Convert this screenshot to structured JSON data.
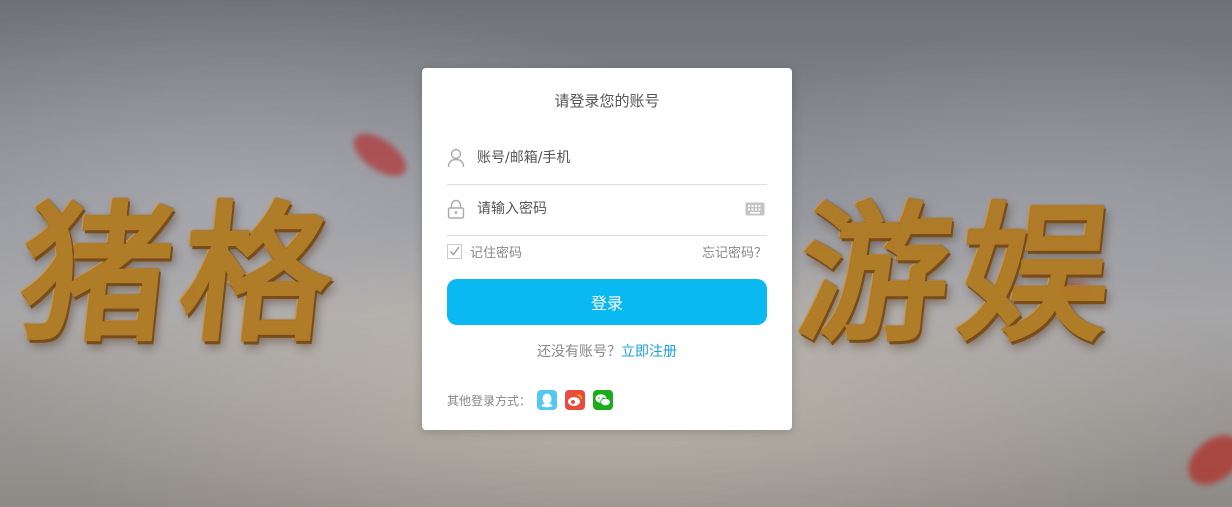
{
  "background": {
    "calligraphy_left": "猪格",
    "calligraphy_right": "游娱"
  },
  "login": {
    "title": "请登录您的账号",
    "username_placeholder": "账号/邮箱/手机",
    "password_placeholder": "请输入密码",
    "remember_label": "记住密码",
    "remember_checked": true,
    "forgot_label": "忘记密码？",
    "submit_label": "登录",
    "register_prompt": "还没有账号？",
    "register_link": "立即注册",
    "other_methods_label": "其他登录方式：",
    "social_methods": [
      "qq-icon",
      "weibo-icon",
      "wechat-icon"
    ]
  },
  "colors": {
    "accent": "#0ab9f2",
    "link": "#1aa0e0",
    "qq": "#52c7f0",
    "weibo": "#e74c3c",
    "wechat": "#1aad19"
  }
}
